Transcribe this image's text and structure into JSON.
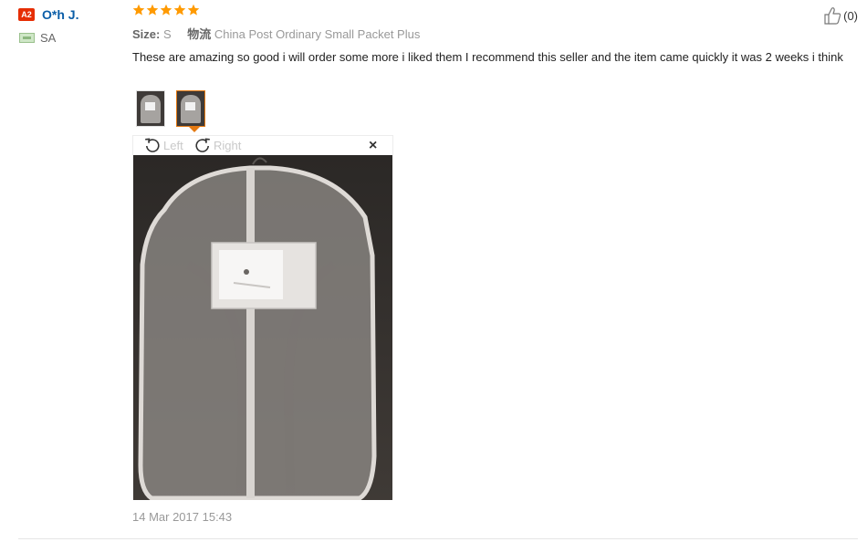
{
  "reviewer": {
    "level_badge": "A2",
    "name": "O*h J.",
    "country": "SA",
    "flag_icon": "flag-icon"
  },
  "rating": {
    "stars": 5,
    "max": 5,
    "icon": "star-icon"
  },
  "attributes": {
    "size_label": "Size:",
    "size_value": "S",
    "logistics_label": "物流",
    "logistics_value": "China Post Ordinary Small Packet Plus"
  },
  "review": {
    "text": "These are amazing so good i will order some more i liked them I recommend this seller and the item came quickly it was 2 weeks i think",
    "timestamp": "14 Mar 2017 15:43"
  },
  "helpful": {
    "icon": "thumbs-up-icon",
    "count_text": "(0)"
  },
  "photos": {
    "thumbnails": [
      "photo-thumbnail-1",
      "photo-thumbnail-2"
    ],
    "selected_index": 1
  },
  "viewer": {
    "rotate_left_label": "Left",
    "rotate_right_label": "Right",
    "close_label": "×"
  },
  "colors": {
    "badge": "#e62e04",
    "name": "#0b5ea8",
    "star": "#ff9a00",
    "selected_border": "#e47911",
    "muted": "#999999"
  }
}
